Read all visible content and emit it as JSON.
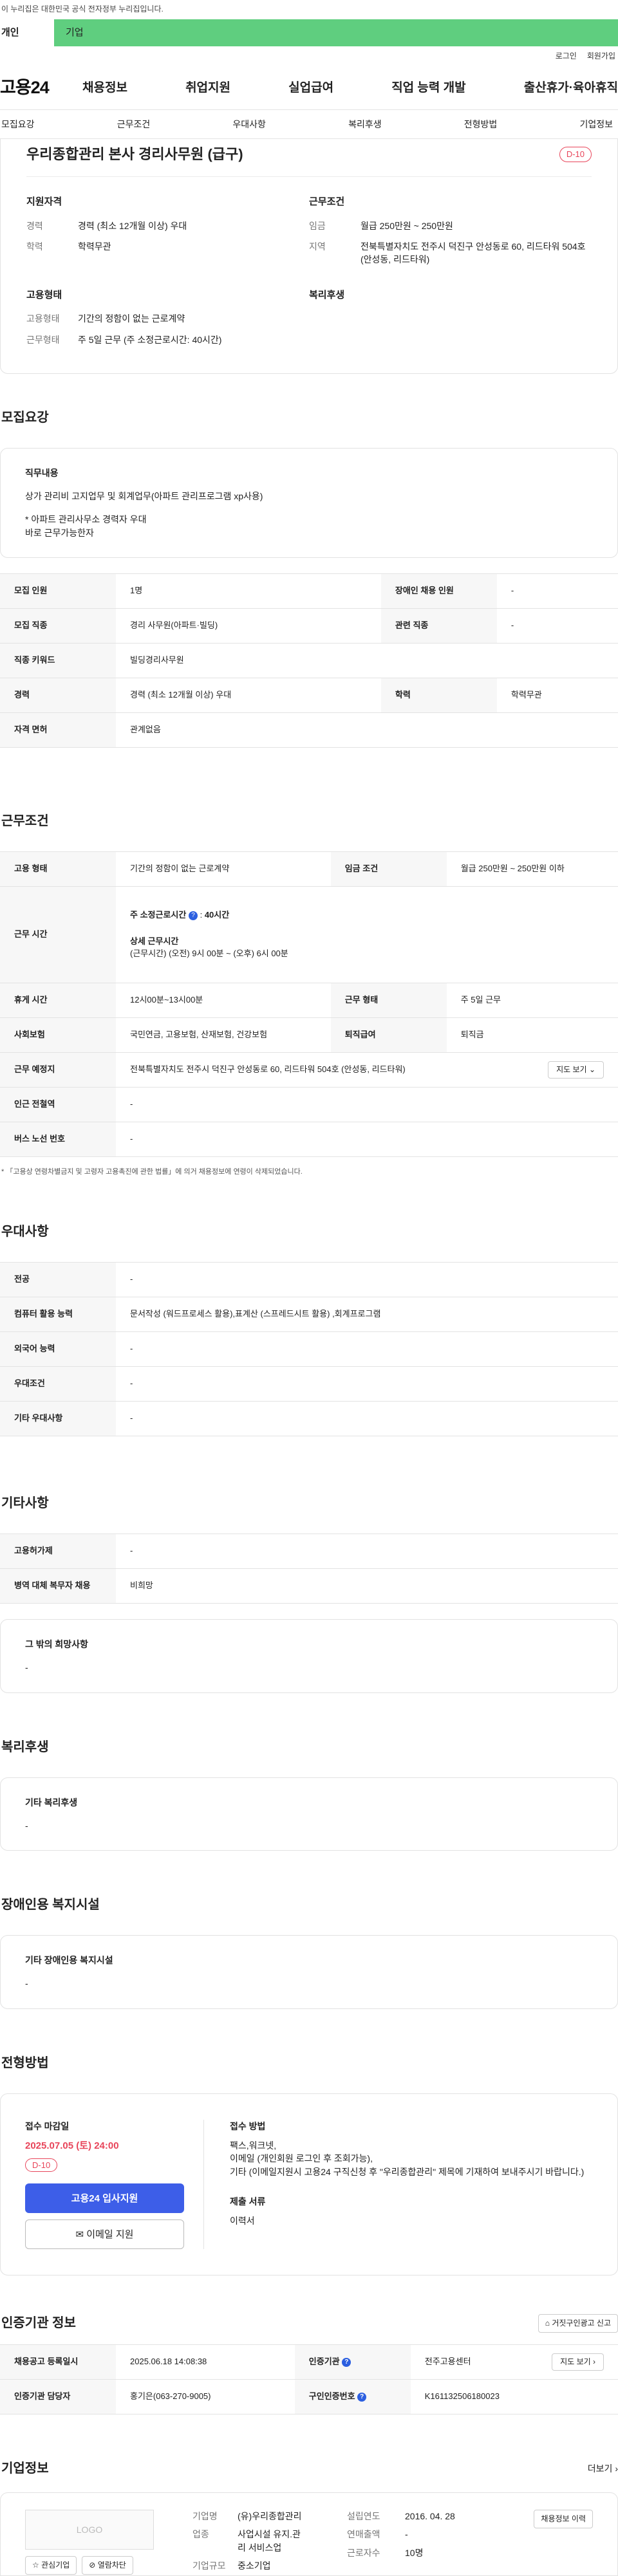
{
  "top_notice": "이 누리집은 대한민국 공식 전자정부 누리집입니다.",
  "audience": {
    "person": "개인",
    "company": "기업"
  },
  "util": {
    "login": "로그인",
    "join": "회원가입"
  },
  "gnb": {
    "logo": "고용24",
    "items": [
      "채용정보",
      "취업지원",
      "실업급여",
      "직업 능력 개발",
      "출산휴가·육아휴직"
    ]
  },
  "tabs": [
    "모집요강",
    "근무조건",
    "우대사항",
    "복리후생",
    "전형방법",
    "기업정보"
  ],
  "summary": {
    "title": "우리종합관리 본사 경리사무원 (급구)",
    "dday": "D-10",
    "qual_title": "지원자격",
    "career_k": "경력",
    "career_v": "경력 (최소 12개월 이상) 우대",
    "edu_k": "학력",
    "edu_v": "학력무관",
    "cond_title": "근무조건",
    "wage_k": "임금",
    "wage_v": "월급 250만원 ~ 250만원",
    "area_k": "지역",
    "area_v": "전북특별자치도 전주시 덕진구 안성동로 60, 리드타워 504호 (안성동, 리드타워)",
    "emp_title": "고용형태",
    "emptype_k": "고용형태",
    "emptype_v": "기간의 정함이 없는 근로계약",
    "worktype_k": "근무형태",
    "worktype_v": "주 5일 근무 (주 소정근로시간: 40시간)",
    "welfare_title": "복리후생"
  },
  "recruit": {
    "heading": "모집요강",
    "job_title": "직무내용",
    "job_desc": "상가 관리비 고지업무 및 회계업무(아파트 관리프로그램 xp사용)",
    "job_note1": "* 아파트 관리사무소 경력자 우대",
    "job_note2": "바로 근무가능한자",
    "rows": {
      "count_k": "모집 인원",
      "count_v": "1명",
      "dis_k": "장애인 채용 인원",
      "dis_v": "-",
      "jobtype_k": "모집 직종",
      "jobtype_v": "경리 사무원(아파트·빌딩)",
      "related_k": "관련 직종",
      "related_v": "-",
      "keyword_k": "직종 키워드",
      "keyword_v": "빌딩경리사무원",
      "career_k": "경력",
      "career_v": "경력 (최소 12개월 이상) 우대",
      "edu_k": "학력",
      "edu_v": "학력무관",
      "license_k": "자격 면허",
      "license_v": "관계없음"
    }
  },
  "work": {
    "heading": "근무조건",
    "emptype_k": "고용 형태",
    "emptype_v": "기간의 정함이 없는 근로계약",
    "wage_k": "임금 조건",
    "wage_v": "월급 250만원 ~ 250만원 이하",
    "hours_k": "근무 시간",
    "hours_main": "주 소정근로시간",
    "hours_main_v": "40시간",
    "hours_detail_t": "상세 근무시간",
    "hours_detail_v": "(근무시간) (오전) 9시 00분 ~ (오후) 6시 00분",
    "break_k": "휴게 시간",
    "break_v": "12시00분~13시00분",
    "worktype_k": "근무 형태",
    "worktype_v": "주 5일 근무",
    "insure_k": "사회보험",
    "insure_v": "국민연금, 고용보험, 산재보험, 건강보험",
    "severance_k": "퇴직급여",
    "severance_v": "퇴직금",
    "place_k": "근무 예정지",
    "place_v": "전북특별자치도 전주시 덕진구 안성동로 60, 리드타워 504호 (안성동, 리드타워)",
    "map_btn": "지도 보기",
    "station_k": "인근 전철역",
    "station_v": "-",
    "bus_k": "버스 노선 번호",
    "bus_v": "-",
    "note": "* 「고용상 연령차별금지 및 고령자 고용촉진에 관한 법률」에 의거 채용정보에 연령이 삭제되었습니다."
  },
  "pref": {
    "heading": "우대사항",
    "major_k": "전공",
    "major_v": "-",
    "pc_k": "컴퓨터 활용 능력",
    "pc_v": "문서작성 (워드프로세스 활용),표계산 (스프레드시트 활용) ,회계프로그램",
    "lang_k": "외국어 능력",
    "lang_v": "-",
    "cond_k": "우대조건",
    "cond_v": "-",
    "etc_k": "기타 우대사항",
    "etc_v": "-"
  },
  "etc": {
    "heading": "기타사항",
    "hire_k": "고용허가제",
    "hire_v": "-",
    "mil_k": "병역 대체 복무자 채용",
    "mil_v": "비희망",
    "wish_title": "그 밖의 희망사항",
    "wish_v": "-"
  },
  "welfare": {
    "heading": "복리후생",
    "title": "기타 복리후생",
    "value": "-"
  },
  "disab": {
    "heading": "장애인용 복지시설",
    "title": "기타 장애인용 복지시설",
    "value": "-"
  },
  "apply": {
    "heading": "전형방법",
    "deadline_t": "접수 마감일",
    "deadline_v": "2025.07.05 (토) 24:00",
    "dday": "D-10",
    "btn_main": "고용24 입사지원",
    "btn_mail": "이메일 지원",
    "method_t": "접수 방법",
    "method_1": "팩스,워크넷,",
    "method_2": "이메일 (개인회원 로그인 후 조회가능),",
    "method_3": "기타 (이메일지원시 고용24 구직신청 후 \"우리종합관리\" 제목에 기재하여 보내주시기 바랍니다.)",
    "docs_t": "제출 서류",
    "docs_v": "이력서"
  },
  "agency": {
    "heading": "인증기관 정보",
    "report_btn": "거짓구인광고 신고",
    "reg_k": "채용공고 등록일시",
    "reg_v": "2025.06.18 14:08:38",
    "org_k": "인증기관",
    "org_v": "전주고용센터",
    "map_btn": "지도 보기",
    "mgr_k": "인증기관 담당자",
    "mgr_v": "홍기은(063-270-9005)",
    "cert_k": "구인인증번호",
    "cert_v": "K161132506180023"
  },
  "company": {
    "heading": "기업정보",
    "more": "더보기",
    "logo": "LOGO",
    "fav_btn": "관심기업",
    "block_btn": "열람차단",
    "name_k": "기업명",
    "name_v": "(유)우리종합관리",
    "industry_k": "업종",
    "industry_v1": "사업시설 유지.관",
    "industry_v2": "리 서비스업",
    "size_k": "기업규모",
    "size_v": "중소기업",
    "founded_k": "설립연도",
    "founded_v": "2016. 04. 28",
    "sales_k": "연매출액",
    "sales_v": "-",
    "emp_k": "근로자수",
    "emp_v": "10명",
    "history_btn": "채용정보 이력"
  }
}
